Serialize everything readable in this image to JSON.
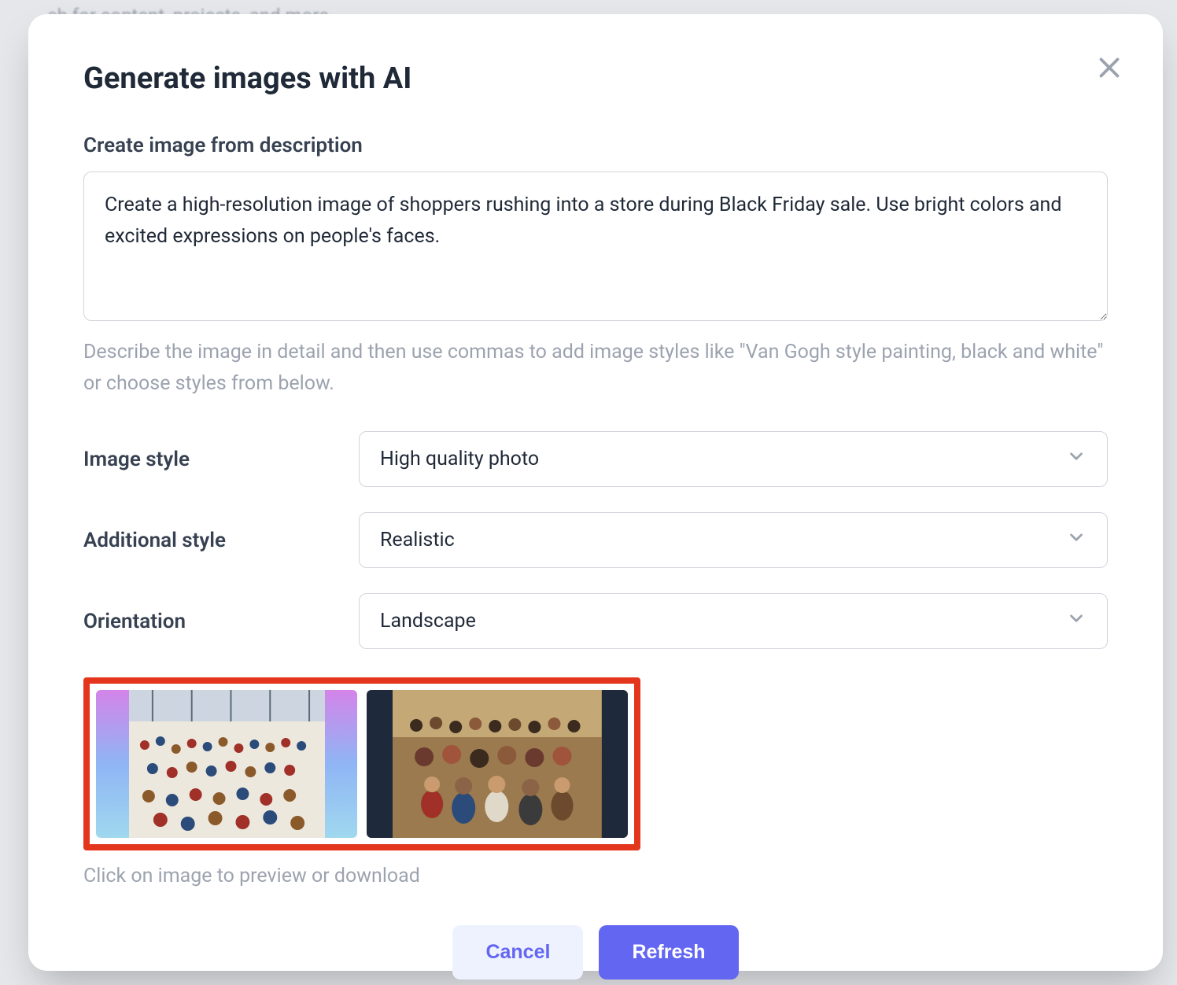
{
  "modal": {
    "title": "Generate images with AI",
    "description_label": "Create image from description",
    "description_value": "Create a high-resolution image of shoppers rushing into a store during Black Friday sale. Use bright colors and excited expressions on people's faces.",
    "helper_text": "Describe the image in detail and then use commas to add image styles like \"Van Gogh style painting, black and white\" or choose styles from below.",
    "fields": {
      "image_style": {
        "label": "Image style",
        "value": "High quality photo"
      },
      "additional_style": {
        "label": "Additional style",
        "value": "Realistic"
      },
      "orientation": {
        "label": "Orientation",
        "value": "Landscape"
      }
    },
    "preview_hint": "Click on image to preview or download",
    "buttons": {
      "cancel": "Cancel",
      "refresh": "Refresh"
    }
  },
  "background": {
    "search_hint": "ch for content, projects, and more"
  }
}
